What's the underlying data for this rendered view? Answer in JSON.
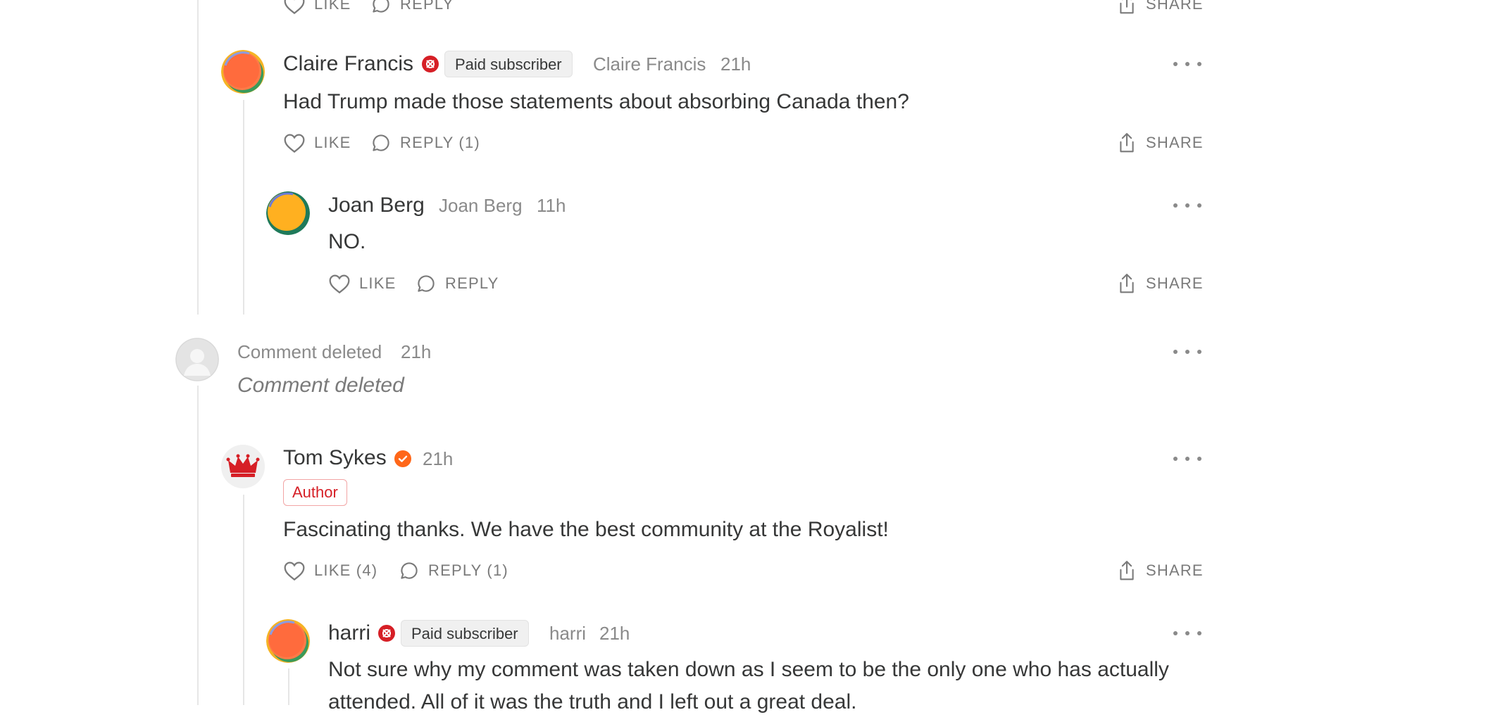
{
  "actions": {
    "like": "LIKE",
    "reply": "REPLY",
    "share": "SHARE"
  },
  "top_partial": {
    "like": "LIKE",
    "reply": "REPLY",
    "share": "SHARE"
  },
  "comments": [
    {
      "author": "Claire Francis",
      "badge": "Paid subscriber",
      "handle": "Claire Francis",
      "time": "21h",
      "text": "Had Trump made those statements about absorbing Canada then?",
      "like_label": "LIKE",
      "reply_label": "REPLY (1)",
      "avatar_colors": [
        "#ff6b3d",
        "#ff7b48",
        "#3a9a5b",
        "#f5b324"
      ]
    },
    {
      "author": "Joan Berg",
      "handle": "Joan Berg",
      "time": "11h",
      "text": "NO.",
      "like_label": "LIKE",
      "reply_label": "REPLY",
      "avatar_colors": [
        "#ffb020",
        "#1f7a5a",
        "#6b7bd6"
      ]
    },
    {
      "author": "Comment deleted",
      "time": "21h",
      "text": "Comment deleted"
    },
    {
      "author": "Tom Sykes",
      "time": "21h",
      "role": "Author",
      "text": "Fascinating thanks. We have the best community at the Royalist!",
      "like_label": "LIKE (4)",
      "reply_label": "REPLY (1)",
      "avatar_icon": "crown-icon"
    },
    {
      "author": "harri",
      "badge": "Paid subscriber",
      "handle": "harri",
      "time": "21h",
      "text_line1": "Not sure why my comment was taken down as I seem to be the only one who has actually",
      "text_line2": "attended. All of it was the truth and I left out a great deal."
    }
  ],
  "colors": {
    "subscriber_badge": "#d61f26",
    "verified_badge": "#ff6719",
    "author_label": "#d61f26",
    "thread_line": "#e6e6e6"
  }
}
